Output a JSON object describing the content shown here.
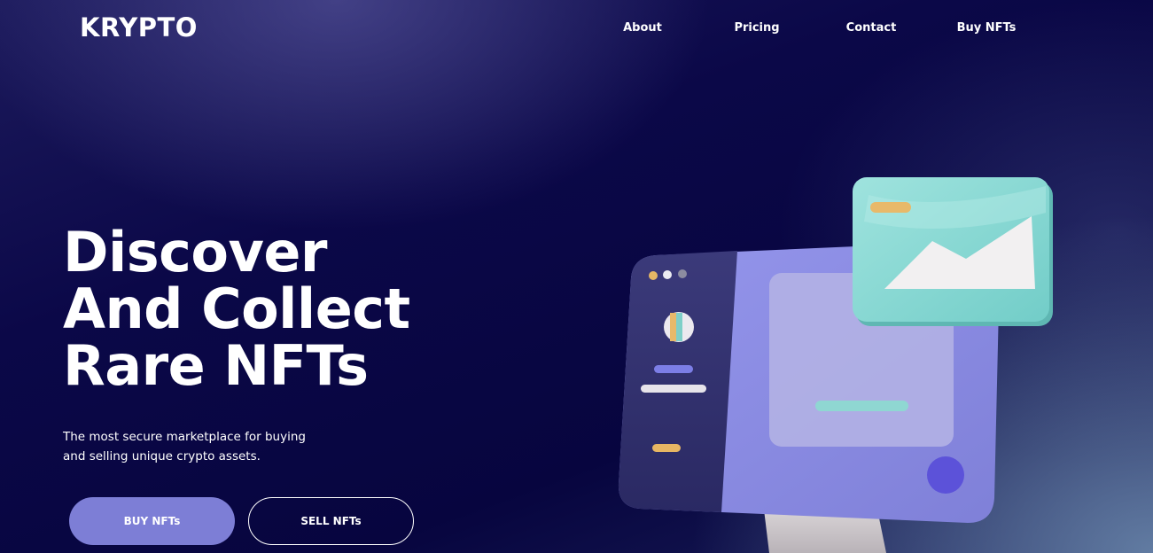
{
  "brand": {
    "logo": "KRYPTO"
  },
  "nav": {
    "items": [
      "About",
      "Pricing",
      "Contact",
      "Buy NFTs"
    ]
  },
  "hero": {
    "headline_lines": [
      "Discover",
      "And Collect",
      "Rare NFTs"
    ],
    "subtitle_lines": [
      "The most secure marketplace for buying",
      "and selling unique crypto assets."
    ],
    "buy_button": "BUY NFTs",
    "sell_button": "SELL NFTs"
  },
  "illustration": {
    "icon": "nft-gallery-3d-illustration"
  },
  "colors": {
    "background": "#0b0848",
    "buy_button": "#7d7ed6",
    "text": "#ffffff",
    "card_teal": "#8dd9d4",
    "panel_purple": "#8a8ae0"
  }
}
